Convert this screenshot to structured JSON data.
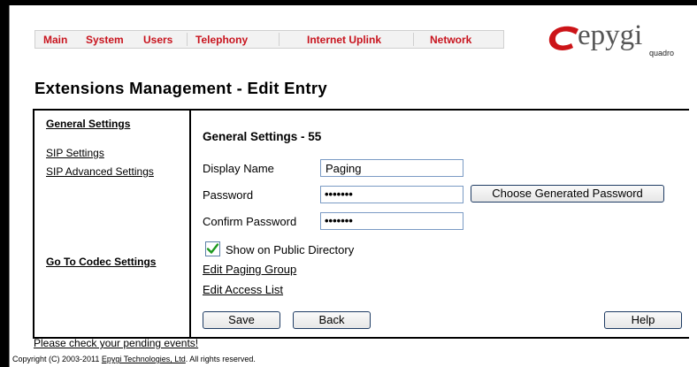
{
  "nav": {
    "items": [
      "Main",
      "System",
      "Users",
      "Telephony",
      "Internet Uplink",
      "Network"
    ]
  },
  "logo": {
    "text": "epygi",
    "sub": "quadro"
  },
  "page_title": "Extensions Management - Edit Entry",
  "sidebar": {
    "general_settings": "General Settings",
    "sip_settings": "SIP Settings",
    "sip_advanced_settings": "SIP Advanced Settings",
    "go_to_codec": "Go To Codec Settings"
  },
  "form": {
    "heading": "General Settings - 55",
    "display_name_label": "Display Name",
    "display_name_value": "Paging",
    "password_label": "Password",
    "password_value": "•••••••",
    "choose_password_button": "Choose Generated Password",
    "confirm_password_label": "Confirm Password",
    "confirm_password_value": "•••••••",
    "public_directory_label": "Show on Public Directory",
    "public_directory_checked": true,
    "edit_paging_group": "Edit Paging Group",
    "edit_access_list": "Edit Access List",
    "save_button": "Save",
    "back_button": "Back",
    "help_button": "Help"
  },
  "footer": {
    "pending_events": "Please check your pending events!",
    "copyright_prefix": "Copyright (C) 2003-2011 ",
    "copyright_link": "Epygi Technologies, Ltd",
    "copyright_suffix": ". All rights reserved."
  },
  "colors": {
    "nav_text": "#c8141e",
    "logo_swoosh": "#cc1418",
    "checkmark": "#1e9a20"
  }
}
